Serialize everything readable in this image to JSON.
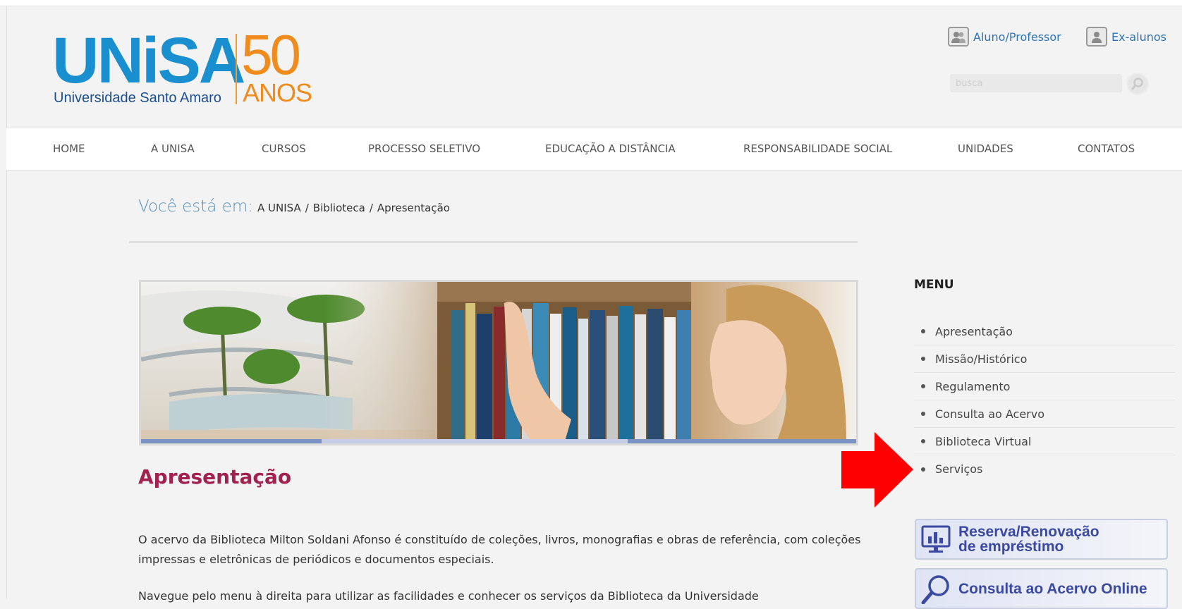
{
  "logo": {
    "word": "UNiSA",
    "subtitle": "Universidade Santo Amaro",
    "anniversary_number": "50",
    "anniversary_word": "ANOS"
  },
  "top_links": {
    "aluno_professor": "Aluno/Professor",
    "ex_alunos": "Ex-alunos"
  },
  "search": {
    "placeholder": "busca"
  },
  "nav": {
    "home": "HOME",
    "a_unisa": "A UNISA",
    "cursos": "CURSOS",
    "processo_seletivo": "PROCESSO SELETIVO",
    "ead": "EDUCAÇÃO A DISTÂNCIA",
    "responsabilidade": "RESPONSABILIDADE SOCIAL",
    "unidades": "UNIDADES",
    "contatos": "CONTATOS"
  },
  "breadcrumb": {
    "lead": "Você está em:",
    "items": [
      "A UNISA",
      "Biblioteca",
      "Apresentação"
    ]
  },
  "article": {
    "title": "Apresentação",
    "paragraph1": "O acervo da Biblioteca Milton Soldani Afonso é constituído de coleções, livros, monografias e obras de referência, com coleções impressas e eletrônicas de periódicos e documentos especiais.",
    "paragraph2": "Navegue pelo menu à direita para utilizar as facilidades e conhecer os serviços da Biblioteca da Universidade"
  },
  "sidebar": {
    "menu_title": "MENU",
    "items": [
      "Apresentação",
      "Missão/Histórico",
      "Regulamento",
      "Consulta ao Acervo",
      "Biblioteca Virtual",
      "Serviços"
    ],
    "promo_reserva_line1": "Reserva/Renovação",
    "promo_reserva_line2": "de empréstimo",
    "promo_consulta": "Consulta ao Acervo Online"
  },
  "colors": {
    "brand_blue": "#1a8fd0",
    "brand_orange": "#f08b1d",
    "title_magenta": "#a3214e",
    "link_blue": "#2e74b5",
    "arrow_red": "#ff0000"
  },
  "icons": {
    "aluno_professor": "users-icon",
    "ex_alunos": "user-icon",
    "search": "search-icon",
    "reserva": "monitor-chart-icon",
    "consulta": "magnifier-icon"
  }
}
